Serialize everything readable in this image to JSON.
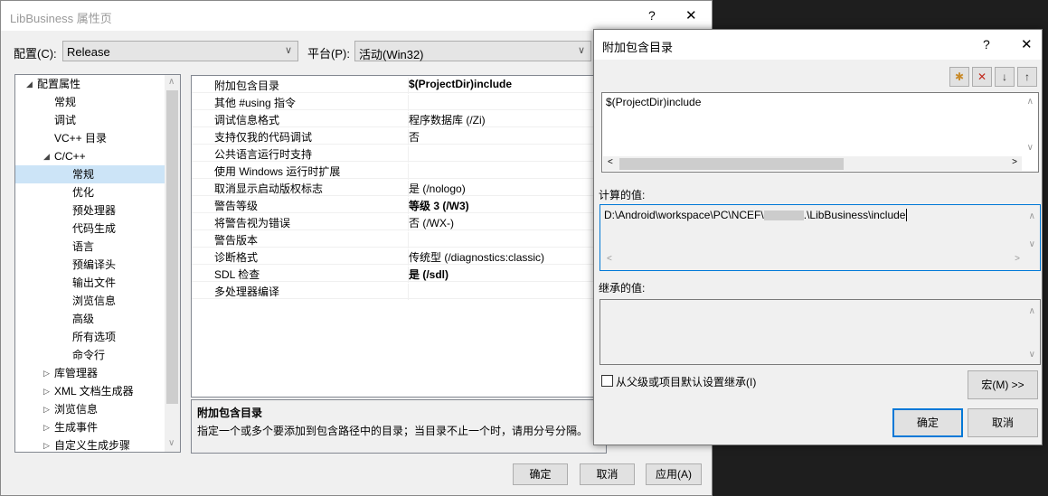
{
  "main": {
    "title": "LibBusiness 属性页",
    "help": "?",
    "close": "✕",
    "config_label": "配置(C):",
    "config_value": "Release",
    "platform_label": "平台(P):",
    "platform_value": "活动(Win32)",
    "tree": [
      {
        "label": "配置属性",
        "level": 0,
        "arrow": "◢"
      },
      {
        "label": "常规",
        "level": 1
      },
      {
        "label": "调试",
        "level": 1
      },
      {
        "label": "VC++ 目录",
        "level": 1
      },
      {
        "label": "C/C++",
        "level": 1,
        "arrow": "◢"
      },
      {
        "label": "常规",
        "level": 2,
        "selected": true
      },
      {
        "label": "优化",
        "level": 2
      },
      {
        "label": "预处理器",
        "level": 2
      },
      {
        "label": "代码生成",
        "level": 2
      },
      {
        "label": "语言",
        "level": 2
      },
      {
        "label": "预编译头",
        "level": 2
      },
      {
        "label": "输出文件",
        "level": 2
      },
      {
        "label": "浏览信息",
        "level": 2
      },
      {
        "label": "高级",
        "level": 2
      },
      {
        "label": "所有选项",
        "level": 2
      },
      {
        "label": "命令行",
        "level": 2
      },
      {
        "label": "库管理器",
        "level": 1,
        "arrow": "▷"
      },
      {
        "label": "XML 文档生成器",
        "level": 1,
        "arrow": "▷"
      },
      {
        "label": "浏览信息",
        "level": 1,
        "arrow": "▷"
      },
      {
        "label": "生成事件",
        "level": 1,
        "arrow": "▷"
      },
      {
        "label": "自定义生成步骤",
        "level": 1,
        "arrow": "▷"
      }
    ],
    "properties": [
      {
        "name": "附加包含目录",
        "value": "$(ProjectDir)include",
        "bold": true
      },
      {
        "name": "其他 #using 指令",
        "value": ""
      },
      {
        "name": "调试信息格式",
        "value": "程序数据库 (/Zi)"
      },
      {
        "name": "支持仅我的代码调试",
        "value": "否"
      },
      {
        "name": "公共语言运行时支持",
        "value": ""
      },
      {
        "name": "使用 Windows 运行时扩展",
        "value": ""
      },
      {
        "name": "取消显示启动版权标志",
        "value": "是 (/nologo)"
      },
      {
        "name": "警告等级",
        "value": "等级 3 (/W3)",
        "bold": true
      },
      {
        "name": "将警告视为错误",
        "value": "否 (/WX-)"
      },
      {
        "name": "警告版本",
        "value": ""
      },
      {
        "name": "诊断格式",
        "value": "传统型 (/diagnostics:classic)"
      },
      {
        "name": "SDL 检查",
        "value": "是 (/sdl)",
        "bold": true
      },
      {
        "name": "多处理器编译",
        "value": ""
      }
    ],
    "desc_title": "附加包含目录",
    "desc_text": "指定一个或多个要添加到包含路径中的目录；当目录不止一个时，请用分号分隔。",
    "ok": "确定",
    "cancel": "取消",
    "apply": "应用(A)"
  },
  "dialog": {
    "title": "附加包含目录",
    "help": "?",
    "close": "✕",
    "entries": [
      "$(ProjectDir)include"
    ],
    "computed_label": "计算的值:",
    "computed_value_start": "D:\\Android\\workspace\\PC\\NCEF\\",
    "computed_value_end": ".\\LibBusiness\\include",
    "inherited_label": "继承的值:",
    "inherit_checkbox": "从父级或项目默认设置继承(I)",
    "inherit_checked": false,
    "macro": "宏(M) >>",
    "ok": "确定",
    "cancel": "取消"
  }
}
